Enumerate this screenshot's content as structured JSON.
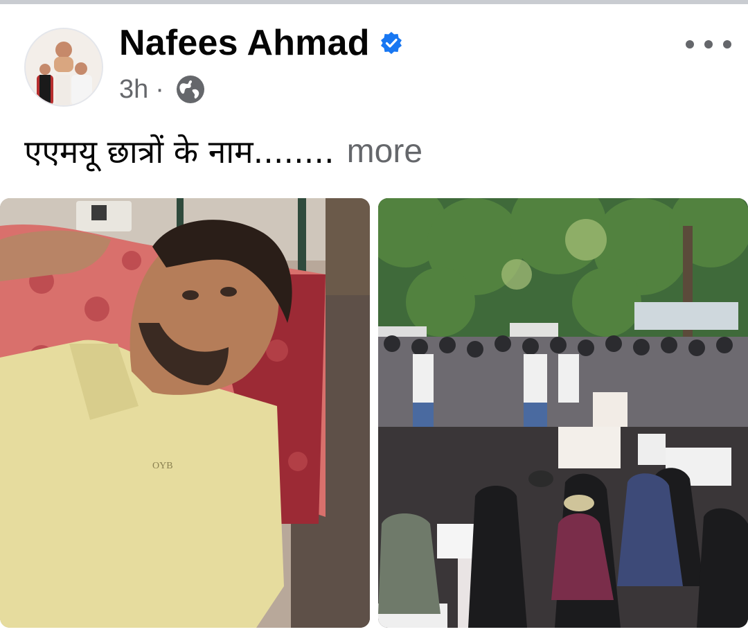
{
  "post": {
    "author_name": "Nafees Ahmad",
    "timestamp": "3h",
    "separator": "·",
    "audience_icon": "globe-icon",
    "verified_icon": "verified-badge-icon",
    "caption_text": "एएमयू छात्रों के नाम........",
    "see_more_label": "more",
    "more_options_icon": "more-options-icon"
  },
  "photos": [
    {
      "name": "photo-man-lying",
      "alt": "Man lying on a bed wearing a yellow polo shirt",
      "shirt_logo": "OYB"
    },
    {
      "name": "photo-protest",
      "alt": "Students gathered at a protest with placards under trees"
    }
  ],
  "colors": {
    "name_text": "#050505",
    "meta_text": "#65676b",
    "verified_blue": "#1877f2",
    "divider": "#c9ccd1"
  }
}
